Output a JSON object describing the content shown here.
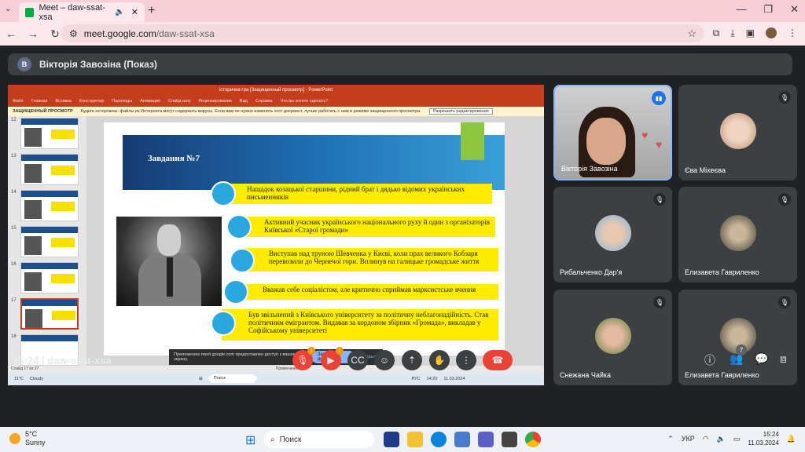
{
  "browser": {
    "tab_title": "Meet – daw-ssat-xsa",
    "url_host": "meet.google.com",
    "url_path": "/daw-ssat-xsa"
  },
  "meet": {
    "presenter_initial": "В",
    "presenter_label": "Вікторія Завозіна (Показ)",
    "time": "15:24",
    "code": "daw-ssat-xsa",
    "participants_count": "7",
    "warn_mark": "!"
  },
  "powerpoint": {
    "title": "історична гра [Защищенный просмотр] - PowerPoint",
    "ribbon_tabs": [
      "Файл",
      "Главная",
      "Вставка",
      "Конструктор",
      "Переходы",
      "Анимация",
      "Слайд-шоу",
      "Рецензирование",
      "Вид",
      "Справка",
      "Что вы хотите сделать?"
    ],
    "protected_label": "ЗАЩИЩЕННЫЙ ПРОСМОТР",
    "protected_text": "Будьте осторожны: файлы из Интернета могут содержать вирусы. Если вам не нужно изменять этот документ, лучше работать с ним в режиме защищенного просмотра.",
    "enable_editing": "Разрешить редактирование",
    "thumb_numbers": [
      "12",
      "13",
      "14",
      "15",
      "16",
      "17",
      "18"
    ],
    "slide_title": "Завдання №7",
    "items": [
      "Нащадок козацької старшини, рідний брат і дядько відомих українських письменників",
      "Активний учасник українського національного руху й один з організаторів Київської «Старої громади»",
      "Виступав над труною Шевченка у Києві, коли прах великого Кобзаря перевозили до Чернечої гори. Вплинув на галицьке громадське життя",
      "Вважав себе соціалістом, але критично сприймав марксистське вчення",
      "Був звільнений з Київського університету за політичну неблагонадійність. Став політичним емігрантом. Видавав за кордоном збірник «Громада», викладав у Софійському університеті"
    ],
    "popup_text": "Приложению meet.google.com предоставлен доступ к вашему экрану.",
    "popup_share": "Закрыть доступ",
    "popup_hide": "Скрыть",
    "status_left": "Слайд 17 из 27",
    "status_notes": "Примечания",
    "inner_search": "Поиск",
    "inner_weather_temp": "11°C",
    "inner_weather_desc": "Cloudy",
    "inner_clock_time": "14:20",
    "inner_clock_date": "11.03.2024",
    "inner_lang": "РУС"
  },
  "tiles": [
    {
      "name": "Вікторія Завозіна"
    },
    {
      "name": "Єва Міхеєва"
    },
    {
      "name": "Рибальченко Дар'я"
    },
    {
      "name": "Елизавета Гавриленко"
    },
    {
      "name": "Снежана Чайка"
    },
    {
      "name": "Елизавета Гавриленко"
    }
  ],
  "windows": {
    "temp": "5°C",
    "weather": "Sunny",
    "search": "Поиск",
    "lang": "УКР",
    "clock_time": "15:24",
    "clock_date": "11.03.2024"
  },
  "colors": {
    "meet_bg": "#202124",
    "hangup": "#ea4335",
    "slide_yellow": "#ffec00",
    "bullet_blue": "#29a8e0",
    "powerpoint": "#c43e1c"
  }
}
